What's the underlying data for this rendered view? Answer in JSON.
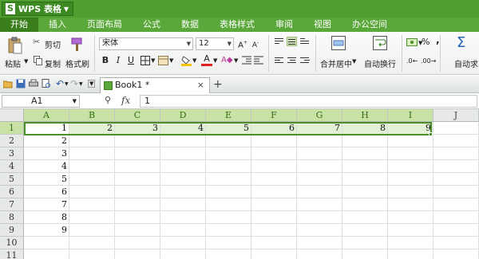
{
  "app": {
    "title": "WPS 表格",
    "logo": "S"
  },
  "menu": [
    "开始",
    "插入",
    "页面布局",
    "公式",
    "数据",
    "表格样式",
    "审阅",
    "视图",
    "办公空间"
  ],
  "ribbon": {
    "paste": "粘贴",
    "cut": "剪切",
    "copy": "复制",
    "format_painter": "格式刷",
    "font_name": "宋体",
    "font_size": "12",
    "bold": "B",
    "italic": "I",
    "underline": "U",
    "font_color_letter": "A",
    "merge_center": "合并居中",
    "wrap": "自动换行",
    "percent": "%",
    "comma": ",",
    "autosum": "自动求"
  },
  "colors": {
    "accent": "#4f9e2f",
    "selection": "#c8e2a6",
    "font_red": "#e02020",
    "fill_yellow": "#f5c400"
  },
  "tabs": {
    "doc_name": "Book1 *",
    "close": "×",
    "add": "+"
  },
  "formula_bar": {
    "name_box": "A1",
    "fx": "fx",
    "value": "1"
  },
  "sheet": {
    "columns": [
      "A",
      "B",
      "C",
      "D",
      "E",
      "F",
      "G",
      "H",
      "I",
      "J"
    ],
    "rows": [
      "1",
      "2",
      "3",
      "4",
      "5",
      "6",
      "7",
      "8",
      "9",
      "10",
      "11"
    ],
    "row1_values": [
      "1",
      "2",
      "3",
      "4",
      "5",
      "6",
      "7",
      "8",
      "9"
    ],
    "col_a_values": [
      "1",
      "2",
      "3",
      "4",
      "5",
      "6",
      "7",
      "8",
      "9"
    ]
  }
}
